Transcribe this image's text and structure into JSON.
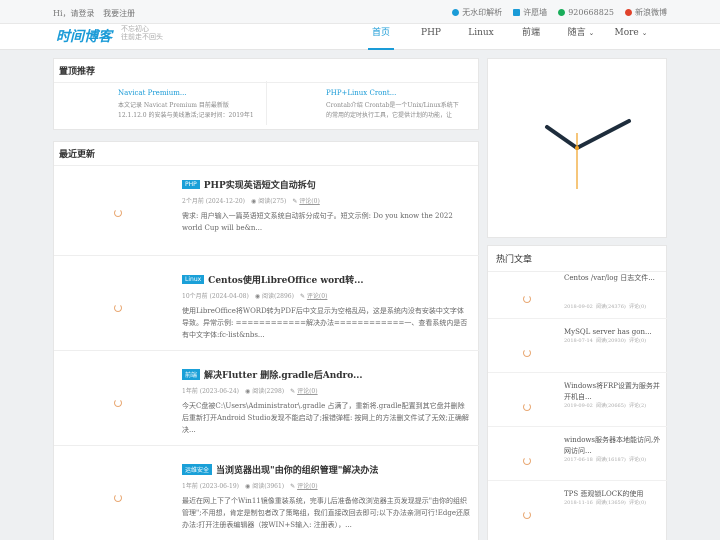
{
  "topbar": {
    "greeting": "Hi，请登录",
    "register": "我要注册",
    "links": [
      {
        "label": "无水印解析",
        "icon": "play-icon",
        "color": "#1a9bd7"
      },
      {
        "label": "许愿墙",
        "icon": "wall-icon",
        "color": "#1a9bd7"
      },
      {
        "label": "920668825",
        "icon": "qq-icon",
        "color": "#19ad5a"
      },
      {
        "label": "新浪微博",
        "icon": "weibo-icon",
        "color": "#e0422b"
      }
    ]
  },
  "header": {
    "logo": "时间博客",
    "slogan_line1": "不忘初心",
    "slogan_line2": "往前走不回头",
    "nav": [
      "首页",
      "PHP",
      "Linux",
      "前端",
      "随言",
      "More"
    ]
  },
  "recommend": {
    "title": "置顶推荐",
    "items": [
      {
        "title": "Navicat Premium...",
        "desc": "本文记录 Navicat Premium 目前最新版 12.1.12.0 的安装与美线激活;记录时间：2019年1"
      },
      {
        "title": "PHP+Linux Cront...",
        "desc": "Crontab介绍 Crontab是一个Unix/Linux系统下的常用的定时执行工具，它提供计划的功能，让"
      }
    ]
  },
  "latest": {
    "title": "最近更新",
    "articles": [
      {
        "tag": "PHP",
        "title": "PHP实现英语短文自动拆句",
        "time": "2个月前 (2024-12-20)",
        "views": "阅读(275)",
        "comments": "评论(0)",
        "desc": "需求: 用户输入一篇英语短文系统自动拆分成句子。短文示例: Do you know the 2022 world Cup will be&n..."
      },
      {
        "tag": "Linux",
        "title": "Centos使用LibreOffice word转...",
        "time": "10个月前 (2024-04-08)",
        "views": "阅读(2896)",
        "comments": "评论(0)",
        "desc": "使用LibreOffice将WORD转为PDF后中文显示为空格乱码，这是系统内没有安装中文字体导致。异常示例: ============解决办法============一、查看系统内是否有中文字体:fc-list&nbs..."
      },
      {
        "tag": "前端",
        "title": "解决Flutter 删除.gradle后Andro...",
        "time": "1年前 (2023-06-24)",
        "views": "阅读(2298)",
        "comments": "评论(0)",
        "desc": "今天C盘被C:\\Users\\Administrator\\.gradle 占满了，重新将.gradle配置到其它盘并删除后重新打开Android Studio发现不能启动了;报错弹框: 按网上的方法删文件试了无效;正确解决..."
      },
      {
        "tag": "运维安全",
        "title": "当浏览器出现\"由你的组织管理\"解决办法",
        "time": "1年前 (2023-06-19)",
        "views": "阅读(3961)",
        "comments": "评论(0)",
        "desc": "最近在网上下了个Win11镜像重装系统，完事儿后准备修改浏览器主页发现提示\"由你的组织管理\";不用想，肯定是制包者改了策略组，我们直接改回去即可;以下办法亲测可行!Edge还原办法:打开注册表编辑器（按WIN+S输入: 注册表），..."
      }
    ]
  },
  "hot": {
    "title": "热门文章",
    "items": [
      {
        "title": "Centos /var/log 日志文件...",
        "date": "2018-09-02",
        "views": "阅读(24376)",
        "comments": "评论(0)"
      },
      {
        "title": "MySQL server has gon...",
        "date": "2018-07-14",
        "views": "阅读(20930)",
        "comments": "评论(0)"
      },
      {
        "title": "Windows将FRP设置为服务并开机自...",
        "date": "2019-09-02",
        "views": "阅读(20665)",
        "comments": "评论(2)"
      },
      {
        "title": "windows服务器本地能访问,外网访问...",
        "date": "2017-06-18",
        "views": "阅读(16187)",
        "comments": "评论(0)"
      },
      {
        "title": "TPS 悲观锁LOCK的使用",
        "date": "2018-11-16",
        "views": "阅读(13659)",
        "comments": "评论(0)"
      }
    ]
  },
  "colors": {
    "accent": "#1a9bd7",
    "tag": "#1aa0d8",
    "clock_hands": "#1e2d3c",
    "clock_second": "#f0a020"
  }
}
